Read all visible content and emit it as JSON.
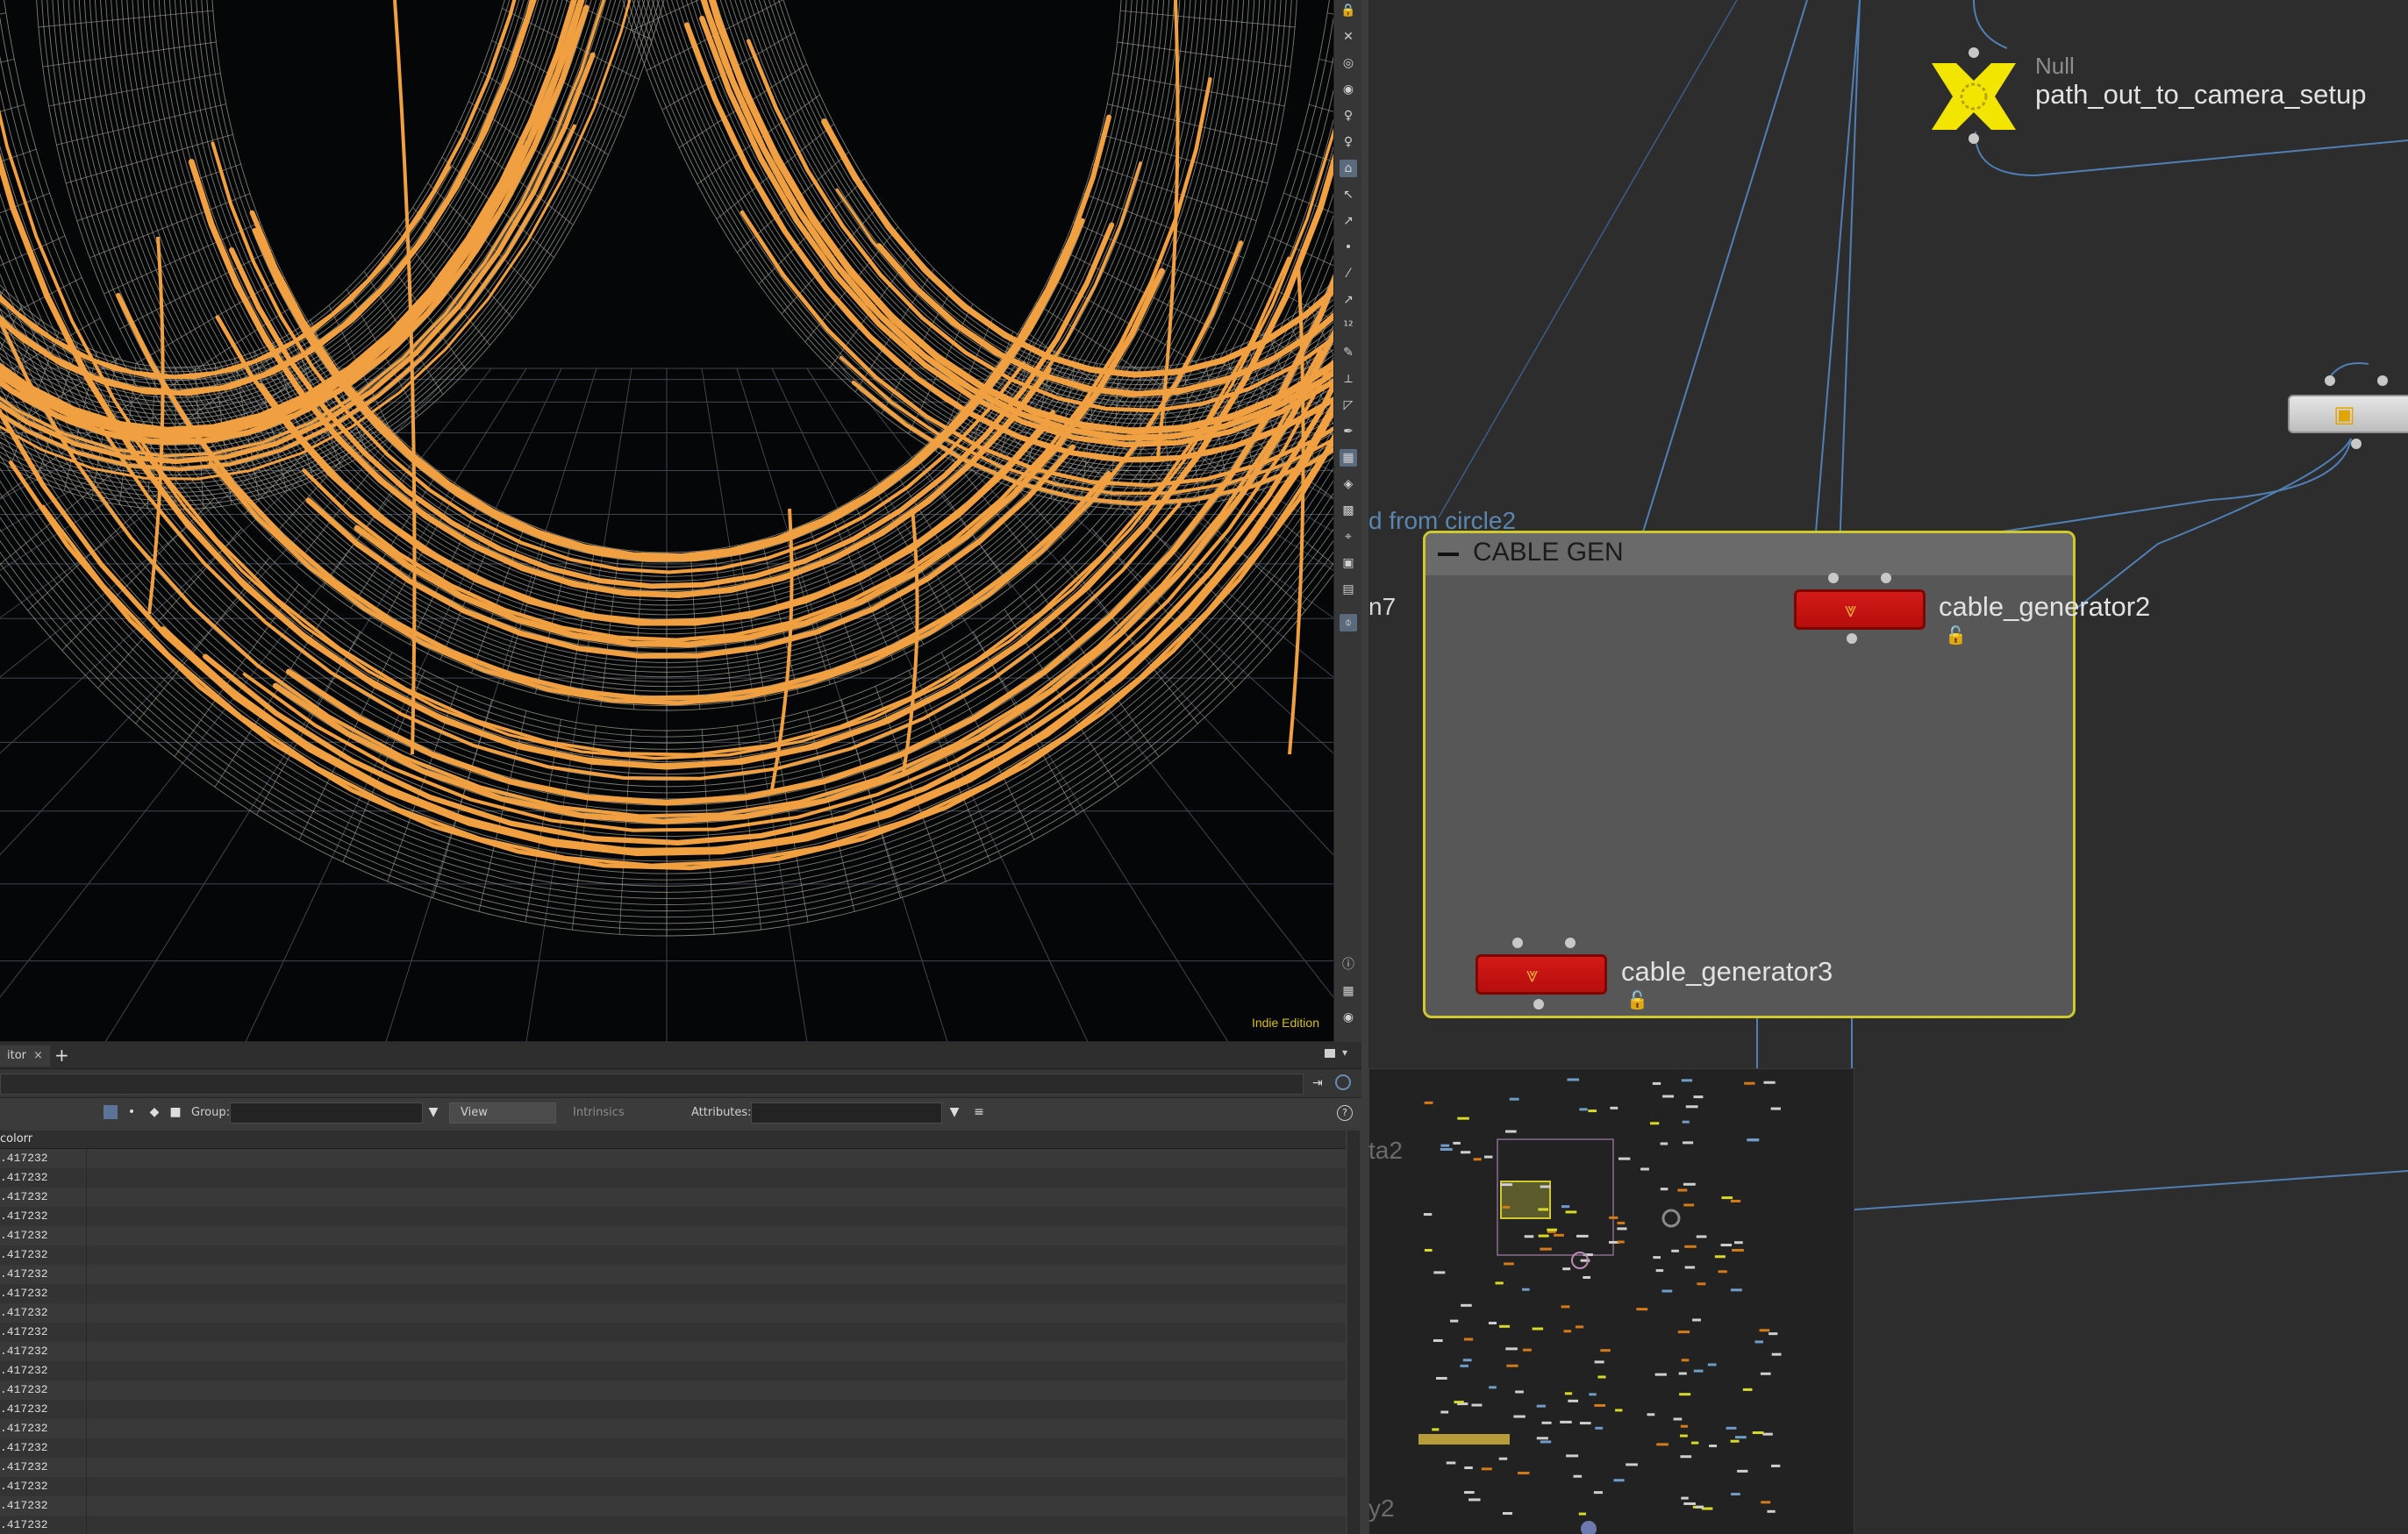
{
  "viewport": {
    "watermark": "Indie Edition",
    "colors": {
      "wire": "#a7a497",
      "curves": "#f0a040",
      "ground_grid": "#3f4650",
      "watermark": "#d4c11a"
    }
  },
  "viewport_toolbar": {
    "icons": [
      "lock-icon",
      "close-icon",
      "sphere-icon",
      "light-icon",
      "light-icon-2",
      "light-icon-3",
      "camera-icon",
      "select-icon",
      "transform-icon",
      "point-icon",
      "edge-icon",
      "primitive-icon",
      "number-icon",
      "paint-icon",
      "brush-icon",
      "ruler-icon",
      "pen-icon",
      "wireframe-icon",
      "shaded-icon",
      "texture-icon",
      "tool-icon",
      "snapshot-icon",
      "render-icon",
      "pin-icon",
      "info-icon",
      "grid-icon",
      "eye-icon"
    ]
  },
  "spreadsheet": {
    "tab_label": "itor",
    "tab_close": "×",
    "tab_add": "+",
    "group_label": "Group:",
    "view_label": "View",
    "intrinsics_label": "Intrinsics",
    "attributes_label": "Attributes:",
    "help": "?",
    "column_header": "colorr",
    "rows": [
      ".417232",
      ".417232",
      ".417232",
      ".417232",
      ".417232",
      ".417232",
      ".417232",
      ".417232",
      ".417232",
      ".417232",
      ".417232",
      ".417232",
      ".417232",
      ".417232",
      ".417232",
      ".417232",
      ".417232",
      ".417232",
      ".417232",
      ".417232"
    ]
  },
  "network": {
    "null_node": {
      "type": "Null",
      "name": "path_out_to_camera_setup",
      "color": "#f2e600"
    },
    "network_box": {
      "title": "CABLE GEN",
      "border_color": "#cfc92e"
    },
    "nodes": [
      {
        "name": "cable_generator2"
      },
      {
        "name": "cable_generator3"
      }
    ],
    "fragment_labels": {
      "from_circle": "d from circle2",
      "n7": "n7",
      "ta2": "ta2",
      "y2": "y2"
    }
  }
}
